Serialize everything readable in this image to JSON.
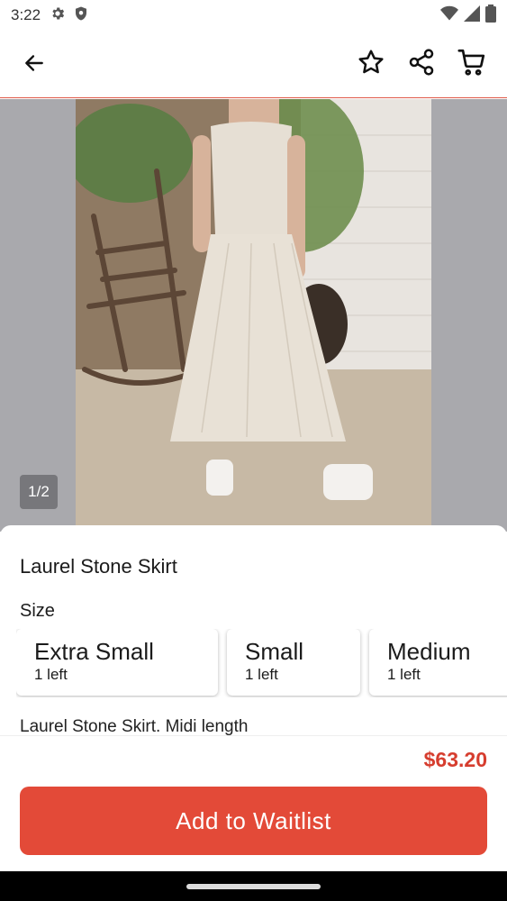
{
  "status_bar": {
    "time": "3:22",
    "left_icons": [
      "gear-icon",
      "shield-icon"
    ],
    "right_icons": [
      "wifi-icon",
      "signal-icon",
      "battery-icon"
    ]
  },
  "app_bar": {
    "icons": [
      "back-arrow-icon",
      "star-icon",
      "share-icon",
      "cart-icon"
    ]
  },
  "gallery": {
    "page_indicator": "1/2",
    "current_page": 1,
    "total_pages": 2
  },
  "product": {
    "name": "Laurel Stone Skirt",
    "size_heading": "Size",
    "sizes": [
      {
        "name": "Extra Small",
        "stock": "1 left"
      },
      {
        "name": "Small",
        "stock": "1 left"
      },
      {
        "name": "Medium",
        "stock": "1 left"
      }
    ],
    "description": "Laurel Stone Skirt. Midi length",
    "price": "$63.20"
  },
  "cta": {
    "label": "Add to Waitlist"
  },
  "colors": {
    "accent": "#e34a38",
    "price": "#d63d2e",
    "gallery_bg": "#a9a9ad"
  }
}
